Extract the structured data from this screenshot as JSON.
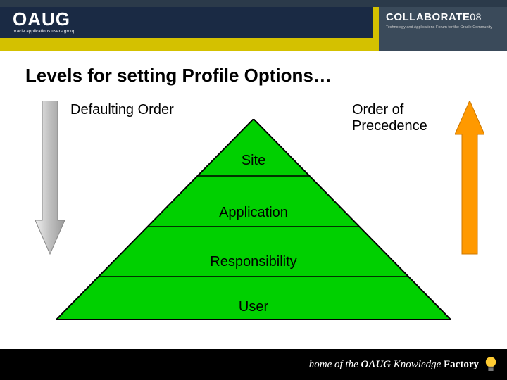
{
  "header": {
    "logo_text": "OAUG",
    "logo_sub": "oracle applications users group",
    "collab_main": "COLLABORATE",
    "collab_year": "08",
    "collab_sub": "Technology and Applications Forum for the Oracle Community"
  },
  "title": "Levels for setting Profile Options…",
  "diagram": {
    "left_label": "Defaulting Order",
    "right_label": "Order of Precedence",
    "levels": {
      "site": "Site",
      "application": "Application",
      "responsibility": "Responsibility",
      "user": "User"
    }
  },
  "footer": {
    "prefix": "home of the",
    "oaug": "OAUG",
    "brand": "Knowledge",
    "brand2": "Factory"
  },
  "colors": {
    "pyramid_fill": "#00d000",
    "arrow_down": "#c8c8c8",
    "arrow_up": "#ff9900",
    "header_dark": "#1a2a44",
    "accent_yellow": "#d4c100"
  }
}
